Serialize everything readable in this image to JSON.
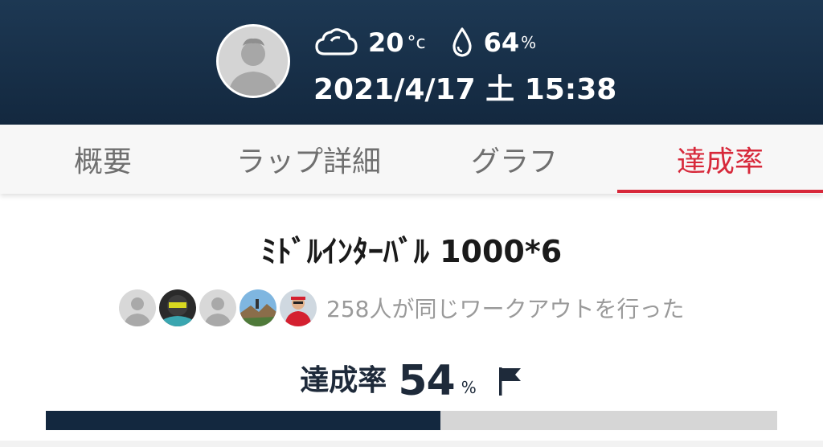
{
  "header": {
    "weather_icon": "cloud-icon",
    "temperature": "20",
    "temperature_unit": "°c",
    "humidity_icon": "drop-icon",
    "humidity": "64",
    "humidity_unit": "%",
    "datetime": "2021/4/17 土 15:38",
    "colors": {
      "background": "#13283f",
      "text": "#ffffff"
    }
  },
  "tabs": [
    {
      "label": "概要",
      "active": false
    },
    {
      "label": "ラップ詳細",
      "active": false
    },
    {
      "label": "グラフ",
      "active": false
    },
    {
      "label": "達成率",
      "active": true
    }
  ],
  "workout": {
    "title": "ﾐﾄﾞﾙｲﾝﾀｰﾊﾞﾙ 1000*6",
    "participants_text": "258人が同じワークアウトを行った"
  },
  "achievement": {
    "label": "達成率",
    "value": "54",
    "unit": "%",
    "flag_icon": "flag-icon",
    "progress": 0.54
  },
  "colors": {
    "accent": "#d7283a",
    "progress_fill": "#13283f",
    "progress_track": "#d6d6d6"
  }
}
